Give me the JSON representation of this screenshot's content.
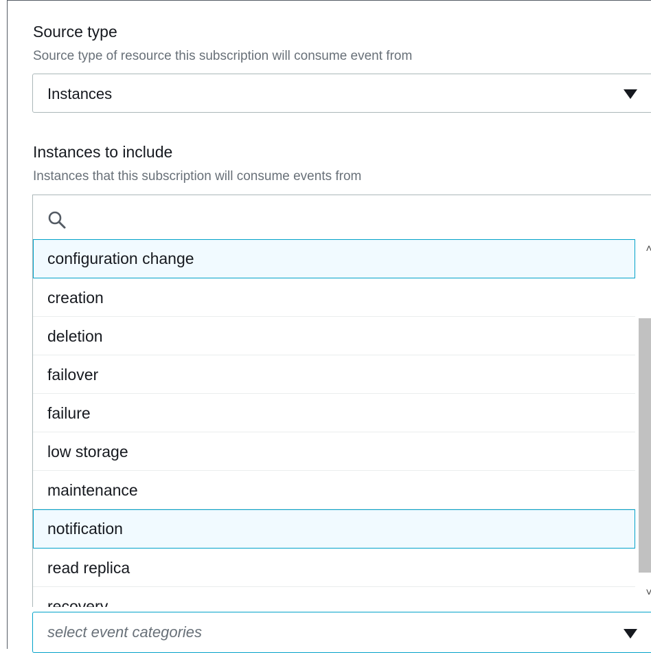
{
  "source_type": {
    "label": "Source type",
    "description": "Source type of resource this subscription will consume event from",
    "selected": "Instances"
  },
  "instances_to_include": {
    "label": "Instances to include",
    "description": "Instances that this subscription will consume events from"
  },
  "event_categories": {
    "placeholder": "select event categories",
    "options": [
      {
        "label": "configuration change",
        "highlighted": true
      },
      {
        "label": "creation",
        "highlighted": false
      },
      {
        "label": "deletion",
        "highlighted": false
      },
      {
        "label": "failover",
        "highlighted": false
      },
      {
        "label": "failure",
        "highlighted": false
      },
      {
        "label": "low storage",
        "highlighted": false
      },
      {
        "label": "maintenance",
        "highlighted": false
      },
      {
        "label": "notification",
        "highlighted": true
      },
      {
        "label": "read replica",
        "highlighted": false
      },
      {
        "label": "recovery",
        "highlighted": false
      }
    ]
  },
  "icons": {
    "search": "search-icon",
    "caret": "caret-down-icon",
    "scroll_up": "chevron-up-icon",
    "scroll_down": "chevron-down-icon"
  },
  "colors": {
    "highlight_bg": "#f1faff",
    "highlight_border": "#00a1c9",
    "description_text": "#687078"
  }
}
